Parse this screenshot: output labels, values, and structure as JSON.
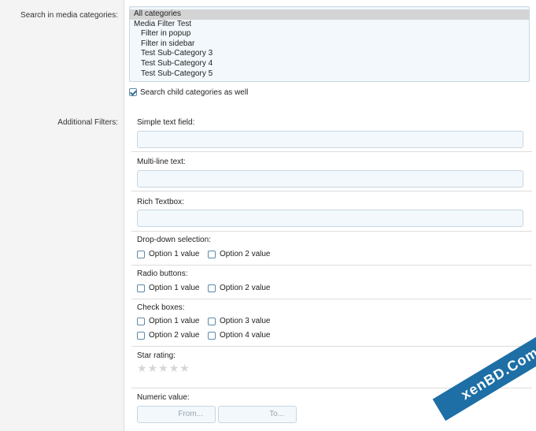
{
  "labels": {
    "search_categories": "Search in media categories:",
    "additional_filters": "Additional Filters:"
  },
  "categories": [
    {
      "label": "All categories",
      "selected": true,
      "sub": false
    },
    {
      "label": "Media Filter Test",
      "selected": false,
      "sub": false
    },
    {
      "label": "Filter in popup",
      "selected": false,
      "sub": true
    },
    {
      "label": "Filter in sidebar",
      "selected": false,
      "sub": true
    },
    {
      "label": "Test Sub-Category 3",
      "selected": false,
      "sub": true
    },
    {
      "label": "Test Sub-Category 4",
      "selected": false,
      "sub": true
    },
    {
      "label": "Test Sub-Category 5",
      "selected": false,
      "sub": true
    }
  ],
  "child_categories": {
    "label": "Search child categories as well",
    "checked": true
  },
  "filters": {
    "simple_text": {
      "title": "Simple text field:",
      "value": ""
    },
    "multi_line": {
      "title": "Multi-line text:",
      "value": ""
    },
    "rich_textbox": {
      "title": "Rich Textbox:",
      "value": ""
    },
    "dropdown": {
      "title": "Drop-down selection:",
      "options": [
        "Option 1 value",
        "Option 2 value"
      ]
    },
    "radio": {
      "title": "Radio buttons:",
      "options": [
        "Option 1 value",
        "Option 2 value"
      ]
    },
    "checkboxes": {
      "title": "Check boxes:",
      "options": [
        "Option 1 value",
        "Option 3 value",
        "Option 2 value",
        "Option 4 value"
      ]
    },
    "star_rating": {
      "title": "Star rating:",
      "value": 0,
      "max": 5
    },
    "numeric": {
      "title": "Numeric value:",
      "from_placeholder": "From...",
      "to_placeholder": "To..."
    }
  },
  "watermark": {
    "text": "xenBD.Com"
  },
  "colors": {
    "accent_blue": "#1d6fa5",
    "input_bg": "#f2f8fc",
    "input_border": "#c8d6e0"
  }
}
